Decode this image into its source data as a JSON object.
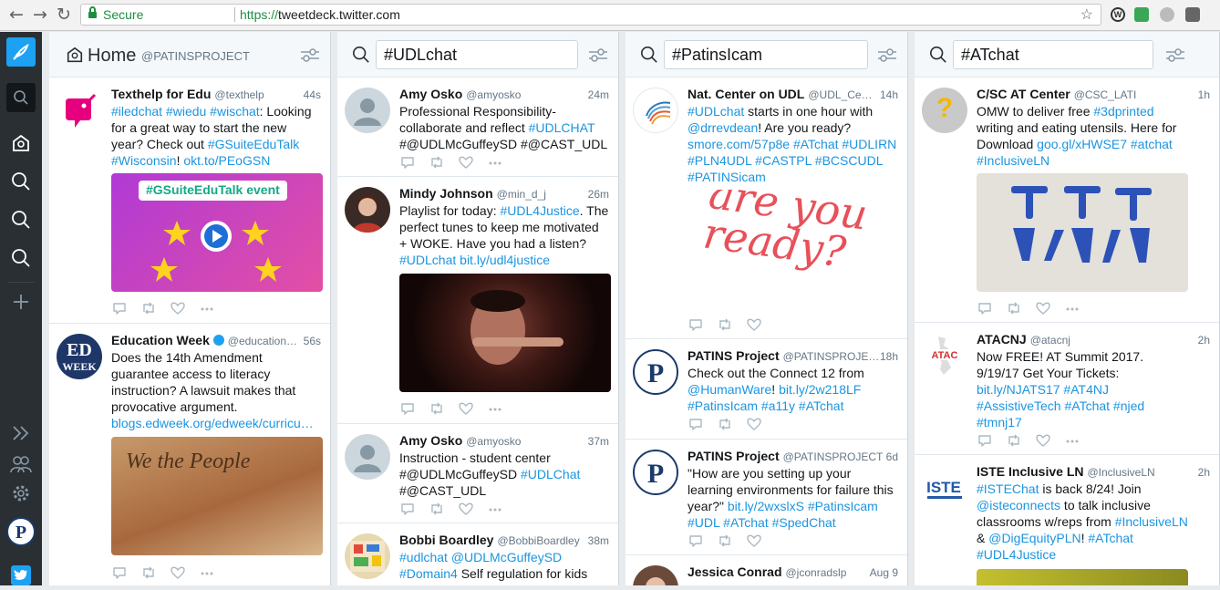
{
  "browser": {
    "secure_label": "Secure",
    "url_scheme": "https://",
    "url_host": "tweetdeck.twitter.com"
  },
  "sidebar": {
    "items": [
      "compose-icon",
      "search-icon",
      "home-icon",
      "search-icon",
      "search-icon",
      "search-icon",
      "add-column-icon",
      "expand-icon",
      "accounts-icon",
      "settings-icon",
      "profile-avatar",
      "twitter-icon"
    ]
  },
  "columns": [
    {
      "number": "1",
      "title": "Home",
      "handle": "@PATINSPROJECT",
      "tweets": [
        {
          "name": "Texthelp for Edu",
          "handle": "@texthelp",
          "time": "44s",
          "text_parts": [
            [
              "#iledchat #wiedu #wischat",
              true
            ],
            [
              ": Looking for a great way to start the new year? Check out ",
              false
            ],
            [
              "#GSuiteEduTalk",
              true
            ],
            [
              " ",
              false
            ],
            [
              "#Wisconsin",
              true
            ],
            [
              "! ",
              false
            ],
            [
              "okt.to/PEoGSN",
              true
            ]
          ],
          "media_label": "#GSuiteEduTalk event"
        },
        {
          "name": "Education Week",
          "handle": "@education…",
          "time": "56s",
          "text_parts": [
            [
              "Does the 14th Amendment guarantee access to literacy instruction? A lawsuit makes that provocative argument. ",
              false
            ],
            [
              "blogs.edweek.org/edweek/curricu…",
              true
            ]
          ],
          "media_label": "We the People"
        }
      ]
    },
    {
      "number": "2",
      "search": "#UDLchat",
      "tweets": [
        {
          "name": "Amy Osko",
          "handle": "@amyosko",
          "time": "24m",
          "text_parts": [
            [
              "Professional Responsibility- collaborate and reflect ",
              false
            ],
            [
              "#UDLCHAT",
              true
            ],
            [
              " #@UDLMcGuffeySD #@CAST_UDL",
              false
            ]
          ]
        },
        {
          "name": "Mindy Johnson",
          "handle": "@min_d_j",
          "time": "26m",
          "text_parts": [
            [
              "Playlist for today: ",
              false
            ],
            [
              "#UDL4Justice",
              true
            ],
            [
              ". The perfect tunes to keep me motivated + WOKE. Have you had a listen? ",
              false
            ],
            [
              "#UDLchat",
              true
            ],
            [
              " ",
              false
            ],
            [
              "bit.ly/udl4justice",
              true
            ]
          ]
        },
        {
          "name": "Amy Osko",
          "handle": "@amyosko",
          "time": "37m",
          "text_parts": [
            [
              "Instruction - student center #@UDLMcGuffeySD ",
              false
            ],
            [
              "#UDLChat",
              true
            ],
            [
              " #@CAST_UDL",
              false
            ]
          ]
        },
        {
          "name": "Bobbi Boardley",
          "handle": "@BobbiBoardley",
          "time": "38m",
          "text_parts": [
            [
              "#udlchat",
              true
            ],
            [
              " ",
              false
            ],
            [
              "@UDLMcGuffeySD",
              true
            ],
            [
              " ",
              false
            ],
            [
              "#Domain4",
              true
            ],
            [
              " Self regulation for kids",
              false
            ]
          ]
        }
      ]
    },
    {
      "number": "3",
      "search": "#PatinsIcam",
      "tweets": [
        {
          "name": "Nat. Center on UDL",
          "handle": "@UDL_Ce…",
          "time": "14h",
          "text_parts": [
            [
              "#UDLchat",
              true
            ],
            [
              " starts in one hour with ",
              false
            ],
            [
              "@drrevdean",
              true
            ],
            [
              "! Are you ready? ",
              false
            ],
            [
              "smore.com/57p8e",
              true
            ],
            [
              " ",
              false
            ],
            [
              "#ATchat #UDLIRN #PLN4UDL #CASTPL #BCSCUDL #PATINSicam",
              true
            ]
          ],
          "media_label": "are you ready?"
        },
        {
          "name": "PATINS Project",
          "handle": "@PATINSPROJE…",
          "time": "18h",
          "text_parts": [
            [
              "Check out the Connect 12 from ",
              false
            ],
            [
              "@HumanWare",
              true
            ],
            [
              "! ",
              false
            ],
            [
              "bit.ly/2w218LF",
              true
            ],
            [
              " ",
              false
            ],
            [
              "#PatinsIcam #a11y #ATchat",
              true
            ]
          ]
        },
        {
          "name": "PATINS Project",
          "handle": "@PATINSPROJECT",
          "time": "6d",
          "text_parts": [
            [
              "\"How are you setting up your learning environments for failure this year?\" ",
              false
            ],
            [
              "bit.ly/2wxslxS",
              true
            ],
            [
              " ",
              false
            ],
            [
              "#PatinsIcam #UDL #ATchat #SpedChat",
              true
            ]
          ]
        },
        {
          "name": "Jessica Conrad",
          "handle": "@jconradslp",
          "time": "Aug 9",
          "text_parts": []
        }
      ]
    },
    {
      "number": "4",
      "search": "#ATchat",
      "tweets": [
        {
          "name": "C/SC AT Center",
          "handle": "@CSC_LATI",
          "time": "1h",
          "text_parts": [
            [
              "OMW to deliver free ",
              false
            ],
            [
              "#3dprinted",
              true
            ],
            [
              " writing and eating utensils. Here for Download ",
              false
            ],
            [
              "goo.gl/xHWSE7",
              true
            ],
            [
              "  ",
              false
            ],
            [
              "#atchat #InclusiveLN",
              true
            ]
          ]
        },
        {
          "name": "ATACNJ",
          "handle": "@atacnj",
          "time": "2h",
          "text_parts": [
            [
              "Now FREE! AT Summit 2017. 9/19/17 Get Your Tickets: ",
              false
            ],
            [
              "bit.ly/NJATS17 #AT4NJ #AssistiveTech #ATchat #njed #tmnj17",
              true
            ]
          ]
        },
        {
          "name": "ISTE Inclusive LN",
          "handle": "@InclusiveLN",
          "time": "2h",
          "text_parts": [
            [
              "#ISTEChat",
              true
            ],
            [
              " is back 8/24! Join ",
              false
            ],
            [
              "@isteconnects",
              true
            ],
            [
              " to talk inclusive classrooms w/reps from ",
              false
            ],
            [
              "#InclusiveLN",
              true
            ],
            [
              " & ",
              false
            ],
            [
              "@DigEquityPLN",
              true
            ],
            [
              "! ",
              false
            ],
            [
              "#ATchat #UDL4Justice",
              true
            ]
          ]
        }
      ]
    }
  ],
  "colors": {
    "link": "#1b95e0",
    "sidebar": "#292f33",
    "accent": "#1da1f2"
  }
}
